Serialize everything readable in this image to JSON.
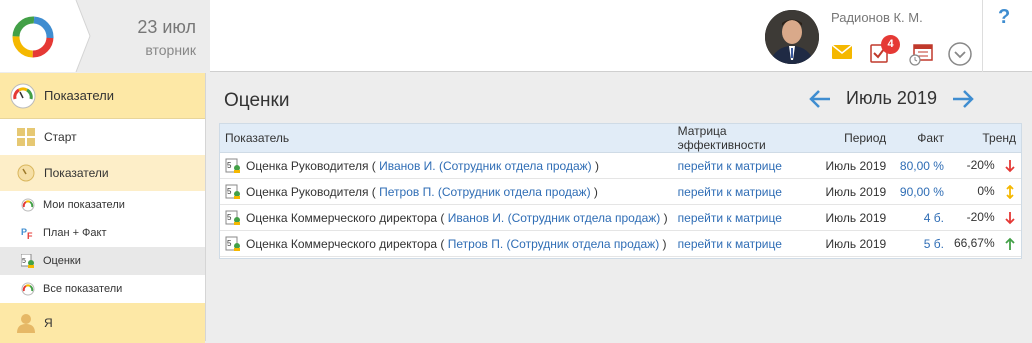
{
  "header": {
    "date_day": "23 июл",
    "date_weekday": "вторник",
    "user_name": "Радионов К. М.",
    "tasks_badge": "4",
    "help": "?"
  },
  "sidebar": {
    "head": "Показатели",
    "items": [
      {
        "label": "Старт"
      },
      {
        "label": "Показатели"
      },
      {
        "label": "Мои показатели"
      },
      {
        "label": "План + Факт"
      },
      {
        "label": "Оценки"
      },
      {
        "label": "Все показатели"
      },
      {
        "label": "Я"
      }
    ]
  },
  "main": {
    "title": "Оценки",
    "period": "Июль 2019",
    "columns": {
      "indicator": "Показатель",
      "matrix": "Матрица эффективности",
      "period": "Период",
      "fact": "Факт",
      "trend": "Тренд"
    },
    "rows": [
      {
        "prefix": "Оценка Руководителя (",
        "person": "Иванов И. (Сотрудник отдела продаж)",
        "suffix": ")",
        "matrix": "перейти к матрице",
        "period": "Июль 2019",
        "fact": "80,00 %",
        "trend": "-20%",
        "trend_dir": "down"
      },
      {
        "prefix": "Оценка Руководителя (",
        "person": "Петров П. (Сотрудник отдела продаж)",
        "suffix": ")",
        "matrix": "перейти к матрице",
        "period": "Июль 2019",
        "fact": "90,00 %",
        "trend": "0%",
        "trend_dir": "flat"
      },
      {
        "prefix": "Оценка Коммерческого директора (",
        "person": "Иванов И. (Сотрудник отдела продаж)",
        "suffix": ")",
        "matrix": "перейти к матрице",
        "period": "Июль 2019",
        "fact": "4 б.",
        "trend": "-20%",
        "trend_dir": "down"
      },
      {
        "prefix": "Оценка Коммерческого директора (",
        "person": "Петров П. (Сотрудник отдела продаж)",
        "suffix": ")",
        "matrix": "перейти к матрице",
        "period": "Июль 2019",
        "fact": "5 б.",
        "trend": "66,67%",
        "trend_dir": "up"
      }
    ]
  },
  "colors": {
    "accent": "#3f8dd0",
    "link": "#2f6db5",
    "down": "#e53935",
    "up": "#43a047",
    "flat": "#f5b800",
    "sidebar_active": "#fde8a6"
  }
}
